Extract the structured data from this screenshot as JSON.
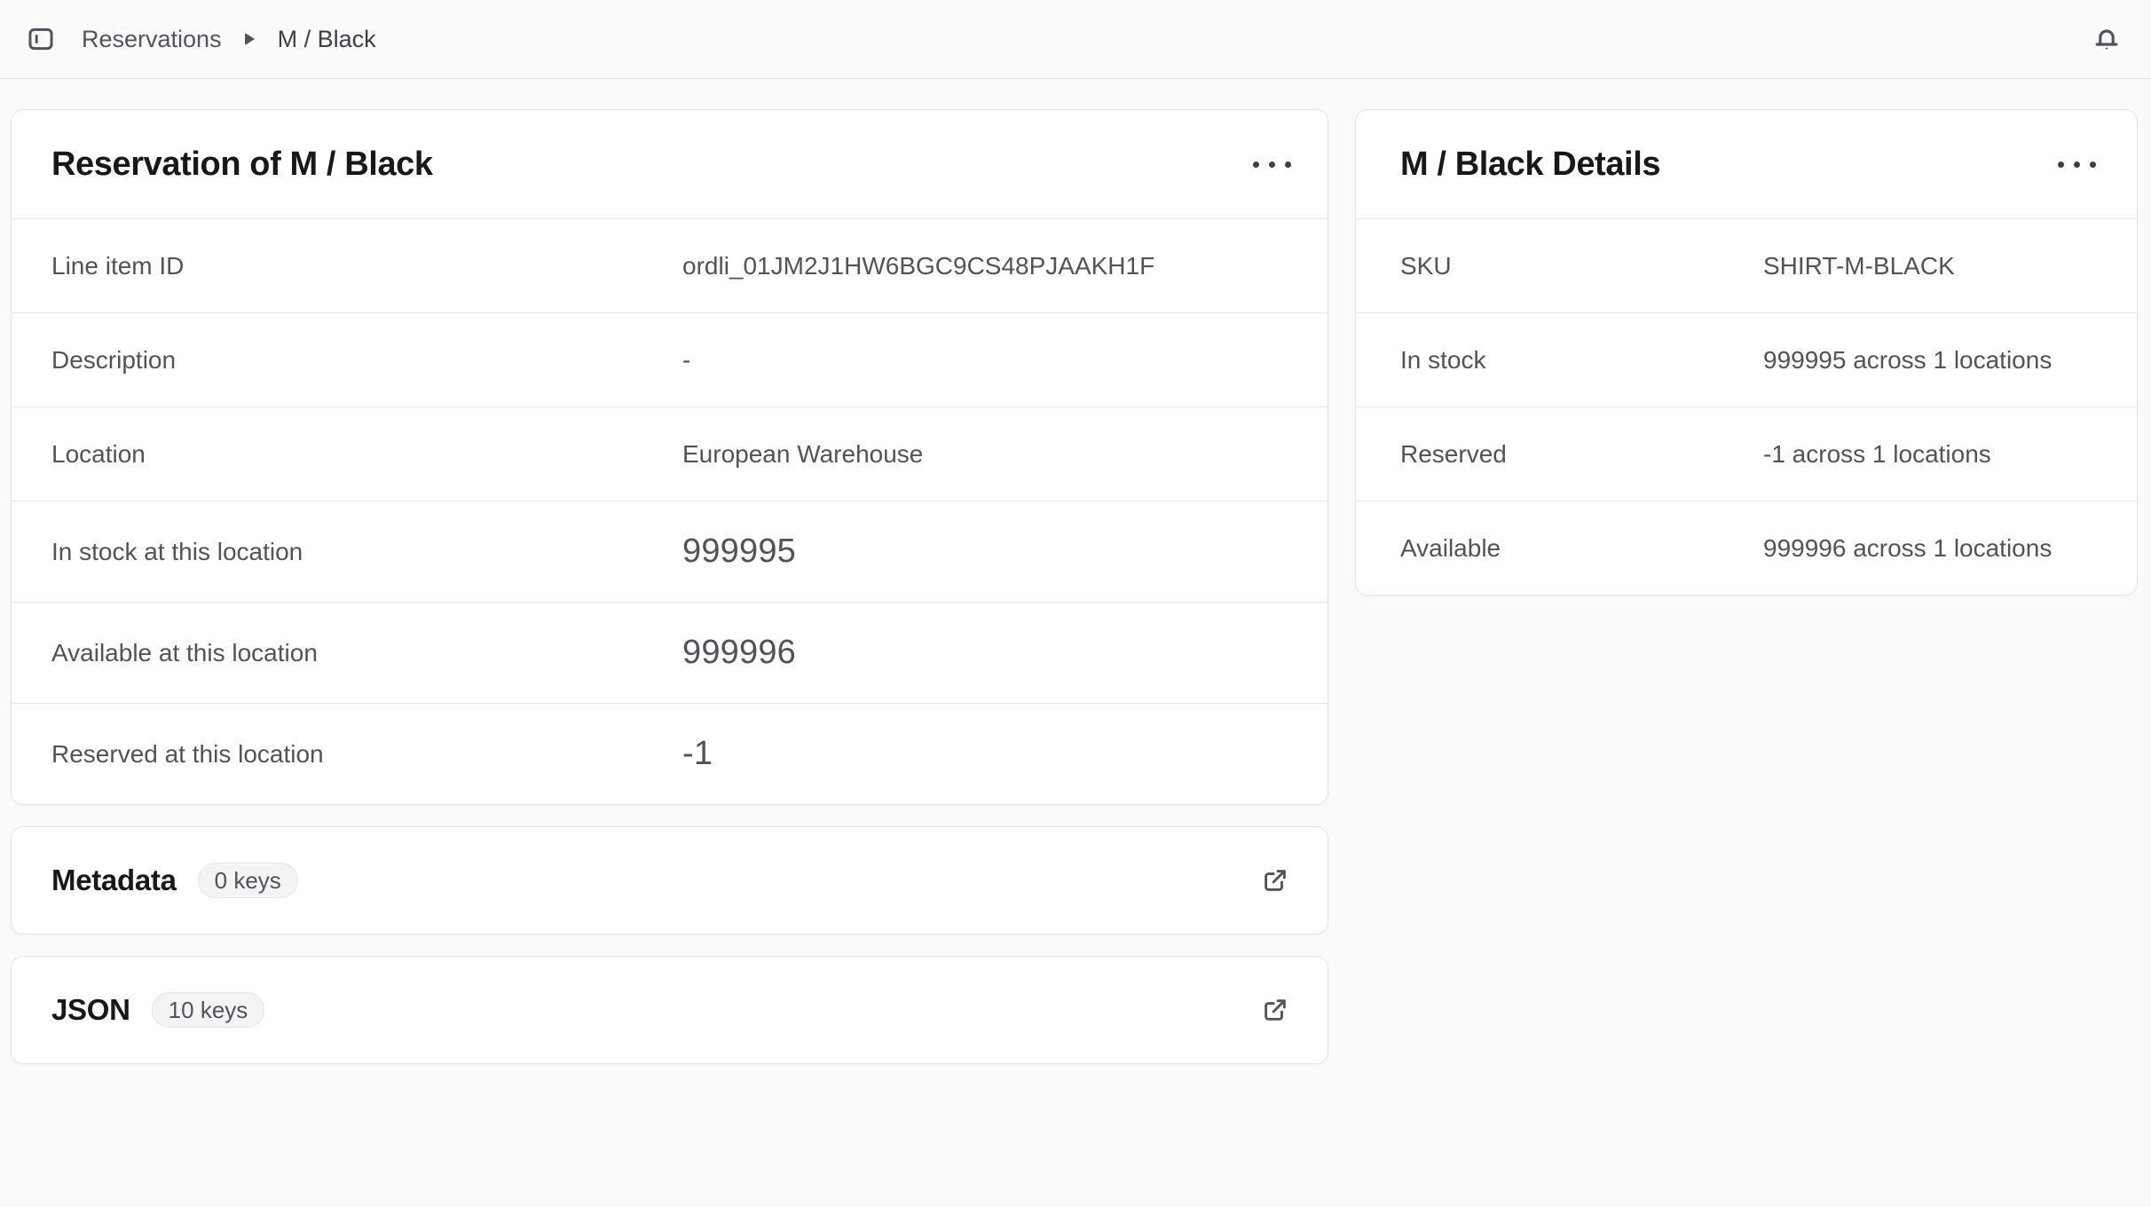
{
  "colors": {
    "page_bg": "#fafafa",
    "card_bg": "#ffffff",
    "border": "#e4e4e7",
    "title_text": "#18181b",
    "body_text": "#52525b"
  },
  "topbar": {
    "breadcrumb": {
      "parent": "Reservations",
      "current": "M / Black"
    },
    "icons": {
      "sidebar_toggle": "panel-left-icon",
      "notifications": "bell-icon"
    }
  },
  "reservation_card": {
    "title": "Reservation of M / Black",
    "menu_icon": "ellipsis-icon",
    "rows": [
      {
        "label": "Line item ID",
        "value": "ordli_01JM2J1HW6BGC9CS48PJAAKH1F"
      },
      {
        "label": "Description",
        "value": "-"
      },
      {
        "label": "Location",
        "value": "European Warehouse"
      },
      {
        "label": "In stock at this location",
        "value": "999995"
      },
      {
        "label": "Available at this location",
        "value": "999996"
      },
      {
        "label": "Reserved at this location",
        "value": "-1"
      }
    ]
  },
  "metadata_card": {
    "title": "Metadata",
    "badge": "0 keys",
    "action_icon": "external-link-icon"
  },
  "json_card": {
    "title": "JSON",
    "badge": "10 keys",
    "action_icon": "external-link-icon"
  },
  "details_card": {
    "title": "M / Black Details",
    "menu_icon": "ellipsis-icon",
    "rows": [
      {
        "label": "SKU",
        "value": "SHIRT-M-BLACK"
      },
      {
        "label": "In stock",
        "value": "999995 across 1 locations"
      },
      {
        "label": "Reserved",
        "value": "-1 across 1 locations"
      },
      {
        "label": "Available",
        "value": "999996 across 1 locations"
      }
    ]
  }
}
